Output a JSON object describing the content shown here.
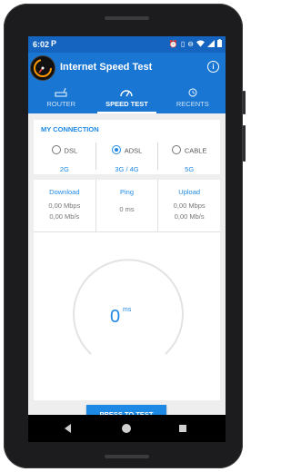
{
  "status_bar": {
    "time": "6:02",
    "notification_icon": "P",
    "icons": [
      "alarm-icon",
      "vibrate-icon",
      "dnd-icon",
      "wifi-icon",
      "signal-icon",
      "battery-icon"
    ]
  },
  "app_bar": {
    "title": "Internet Speed Test",
    "info_icon": "i"
  },
  "tabs": [
    {
      "label": "ROUTER",
      "icon": "router-icon",
      "active": false
    },
    {
      "label": "SPEED TEST",
      "icon": "speedometer-icon",
      "active": true
    },
    {
      "label": "RECENTS",
      "icon": "history-icon",
      "active": false
    }
  ],
  "connection": {
    "title": "MY CONNECTION",
    "options": [
      {
        "name": "DSL",
        "sub": "2G",
        "selected": false
      },
      {
        "name": "ADSL",
        "sub": "3G / 4G",
        "selected": true
      },
      {
        "name": "CABLE",
        "sub": "5G",
        "selected": false
      }
    ]
  },
  "stats": {
    "download": {
      "label": "Download",
      "line1": "0,00 Mbps",
      "line2": "0,00 Mb/s"
    },
    "ping": {
      "label": "Ping",
      "line1": "0 ms"
    },
    "upload": {
      "label": "Upload",
      "line1": "0,00 Mbps",
      "line2": "0,00 Mb/s"
    }
  },
  "gauge": {
    "value": "0",
    "unit": "ms"
  },
  "button": {
    "label": "PRESS TO TEST"
  },
  "colors": {
    "primary": "#1976d2",
    "status_bar": "#1565c0",
    "accent": "#1e88e5",
    "background": "#eeeeee"
  }
}
